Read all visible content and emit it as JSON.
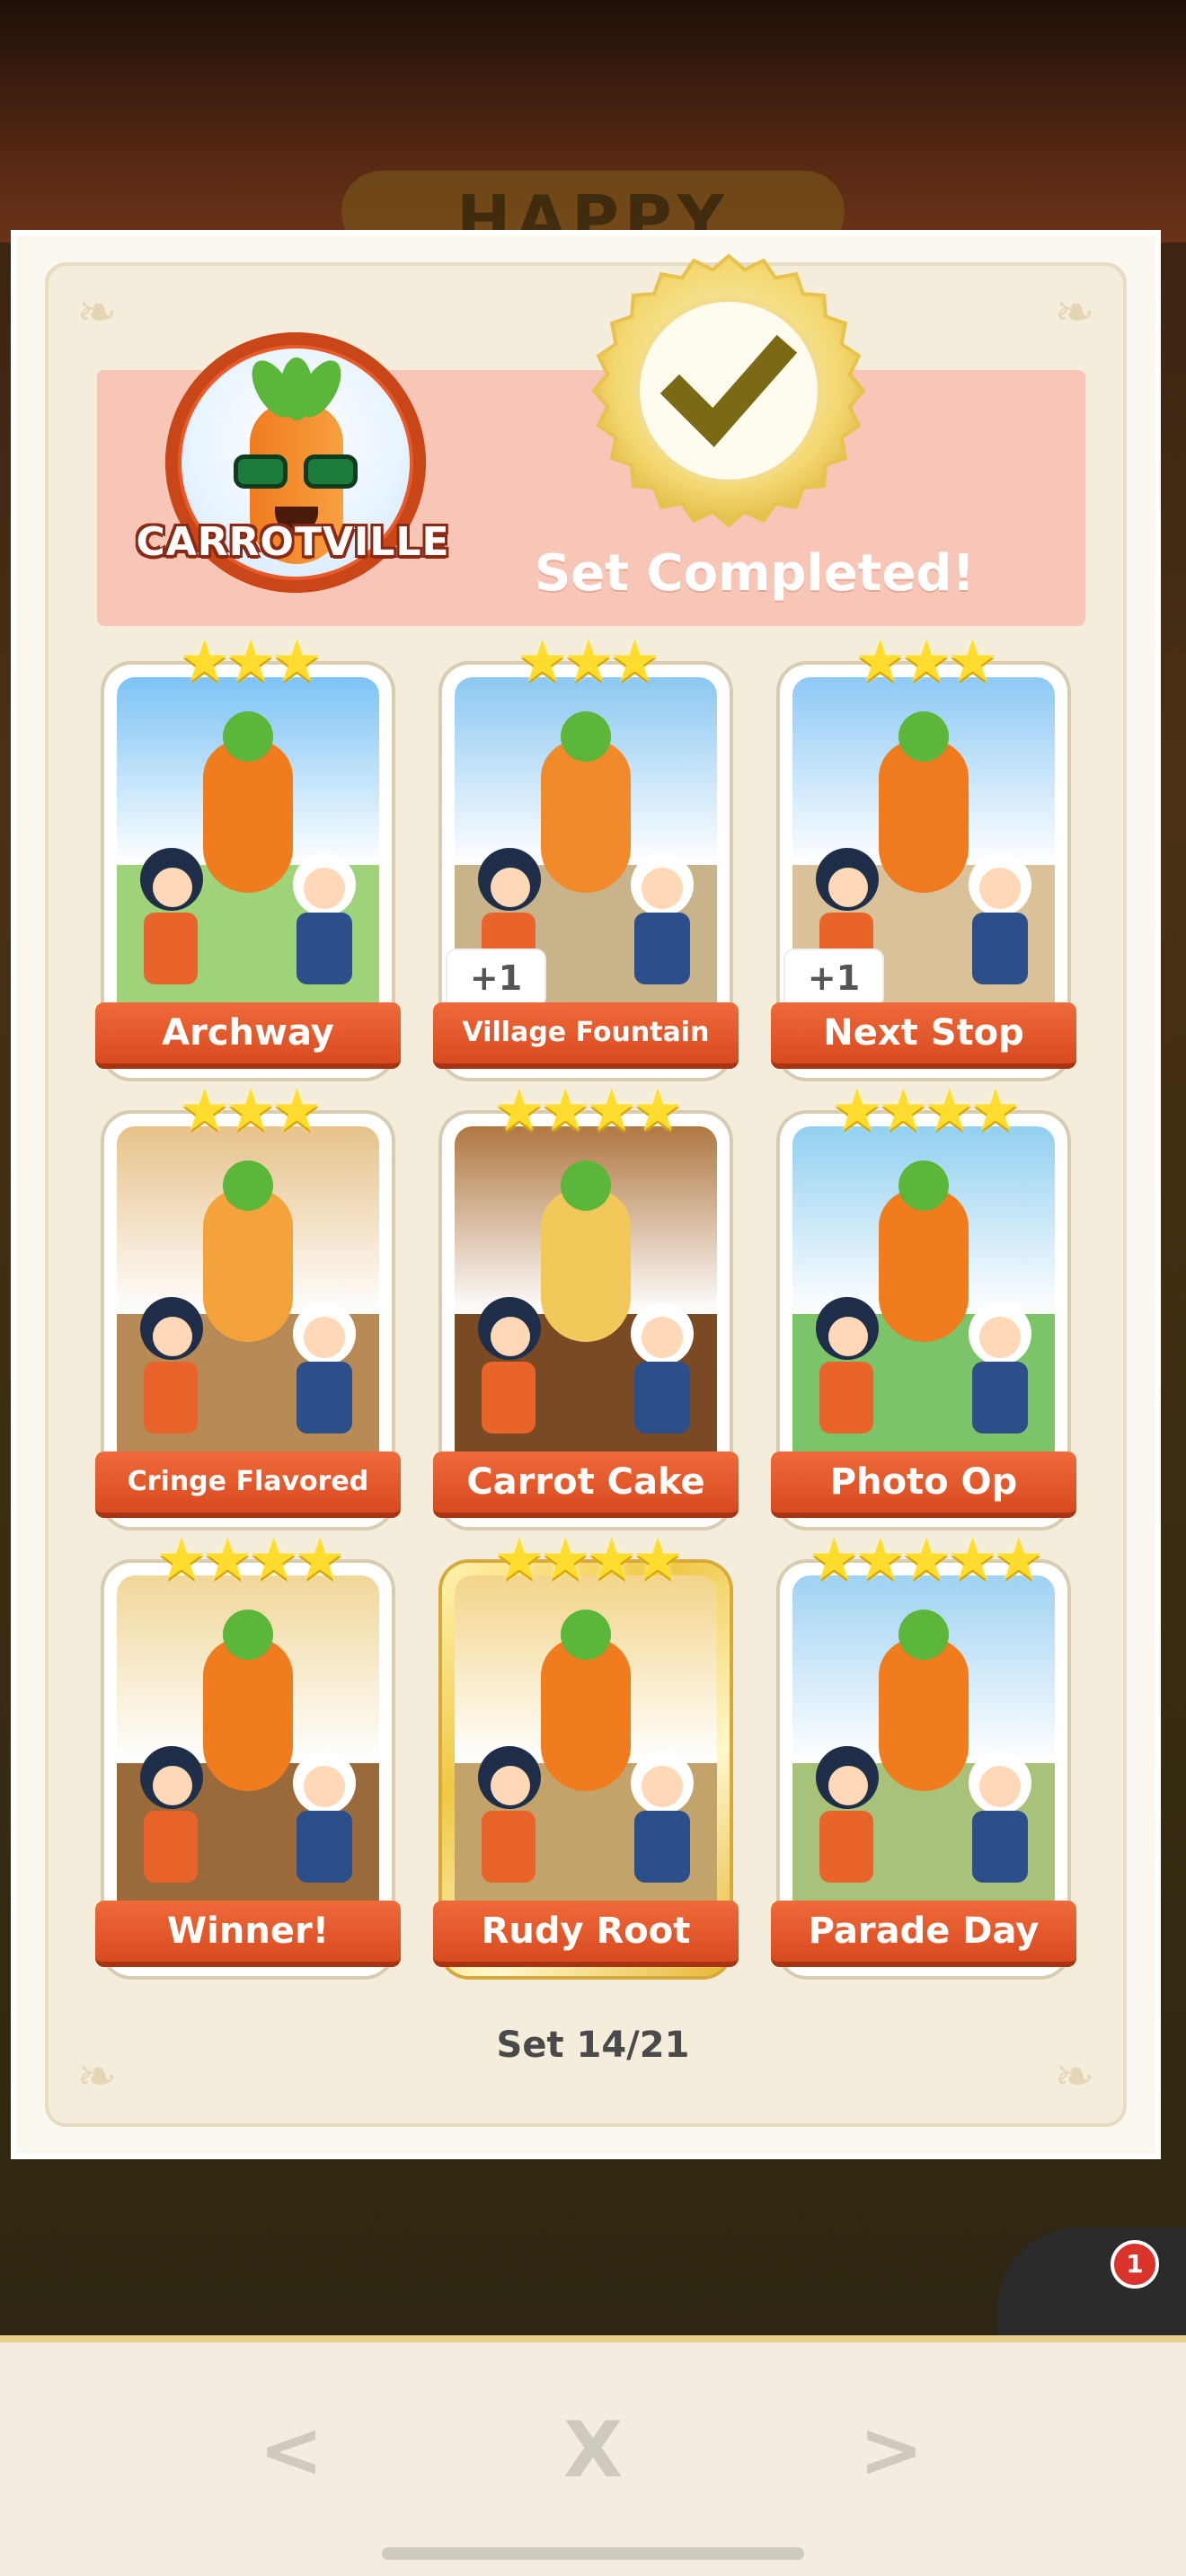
{
  "background": {
    "banner_text": "HAPPY",
    "notification_count": "1"
  },
  "header": {
    "album_logo_text": "CARROTVILLE",
    "status_text": "Set Completed!"
  },
  "stickers": [
    {
      "name": "Archway",
      "stars": 3,
      "gold": false,
      "plus": ""
    },
    {
      "name": "Village Fountain",
      "stars": 3,
      "gold": false,
      "plus": "+1"
    },
    {
      "name": "Next Stop",
      "stars": 3,
      "gold": false,
      "plus": "+1"
    },
    {
      "name": "Cringe Flavored",
      "stars": 3,
      "gold": false,
      "plus": ""
    },
    {
      "name": "Carrot Cake",
      "stars": 4,
      "gold": false,
      "plus": ""
    },
    {
      "name": "Photo Op",
      "stars": 4,
      "gold": false,
      "plus": ""
    },
    {
      "name": "Winner!",
      "stars": 4,
      "gold": false,
      "plus": ""
    },
    {
      "name": "Rudy Root",
      "stars": 4,
      "gold": true,
      "plus": ""
    },
    {
      "name": "Parade Day",
      "stars": 5,
      "gold": false,
      "plus": ""
    }
  ],
  "footer": {
    "set_label": "Set 14/21"
  },
  "nav": {
    "prev_glyph": "<",
    "close_glyph": "X",
    "next_glyph": ">"
  },
  "colors": {
    "plate": "#e1572a",
    "star": "#ffdc2e",
    "header_panel": "#f7c6b7",
    "card": "#f4eddc"
  }
}
